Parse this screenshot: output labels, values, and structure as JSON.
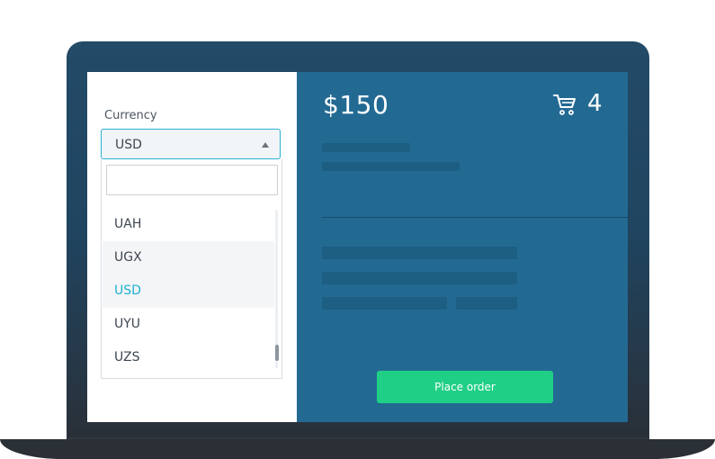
{
  "currency": {
    "label": "Currency",
    "selected": "USD",
    "search_placeholder": "",
    "options": [
      "UAH",
      "UGX",
      "USD",
      "UYU",
      "UZS"
    ]
  },
  "order": {
    "price": "$150",
    "cart_count": "4",
    "place_order_label": "Place order"
  },
  "icons": {
    "cart": "cart-icon",
    "dropdown_caret": "caret-up-icon"
  },
  "colors": {
    "panel_blue": "#236a93",
    "accent_cyan": "#1fb0d1",
    "button_green": "#1fcf86"
  }
}
